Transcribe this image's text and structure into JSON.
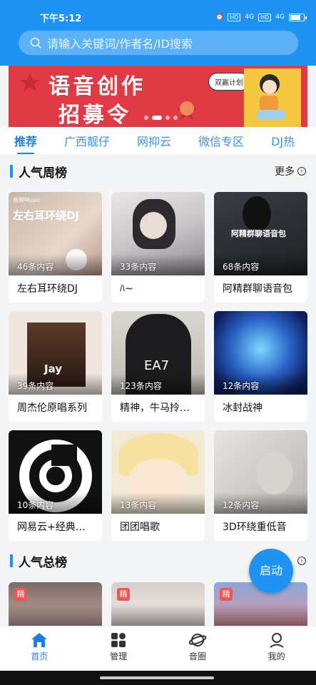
{
  "status": {
    "time": "下午5:12",
    "network1": "4G",
    "network2": "4G",
    "hd": "HD"
  },
  "search": {
    "placeholder": "请输入关键词/作者名/ID搜索"
  },
  "banner": {
    "line1": "语音创作",
    "line2": "招募令",
    "bubble": "双赢计划"
  },
  "tabs": [
    "推荐",
    "广西靓仔",
    "网抑云",
    "微信专区",
    "DJ热"
  ],
  "weekly": {
    "title": "人气周榜",
    "more": "更多",
    "cards": [
      {
        "name": "左右耳环绕DJ",
        "count": "46条内容",
        "cover_text": "左右耳环绕DJ",
        "cover_small": "音频Music"
      },
      {
        "name": "ﾊ~",
        "count": "33条内容"
      },
      {
        "name": "阿精群聊语音包",
        "count": "68条内容",
        "cover_text": "阿精群聊语音包"
      },
      {
        "name": "周杰伦原唱系列",
        "count": "39条内容",
        "cover_text": "Jay"
      },
      {
        "name": "精神，牛马拎…",
        "count": "123条内容",
        "cover_text": "EA7"
      },
      {
        "name": "冰封战神",
        "count": "12条内容"
      },
      {
        "name": "网易云+经典…",
        "count": "10条内容"
      },
      {
        "name": "团团唱歌",
        "count": "13条内容"
      },
      {
        "name": "3D环绕重低音",
        "count": "12条内容"
      }
    ]
  },
  "total": {
    "title": "人气总榜",
    "badge": "精"
  },
  "start_button": "启动",
  "nav": [
    {
      "label": "首页",
      "icon": "home-icon"
    },
    {
      "label": "管理",
      "icon": "grid-icon"
    },
    {
      "label": "音圈",
      "icon": "planet-icon"
    },
    {
      "label": "我的",
      "icon": "user-icon"
    }
  ],
  "colors": {
    "primary": "#1f93f3",
    "banner": "#e03a45"
  }
}
